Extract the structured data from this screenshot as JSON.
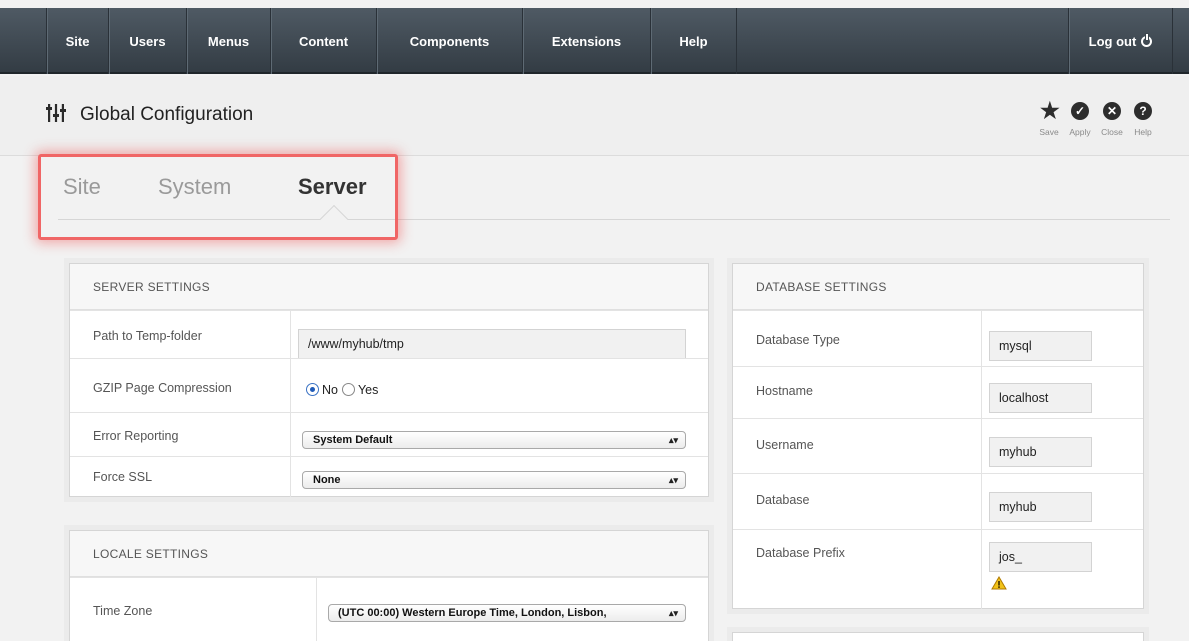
{
  "nav": {
    "items": [
      "Site",
      "Users",
      "Menus",
      "Content",
      "Components",
      "Extensions",
      "Help"
    ],
    "logout": "Log out"
  },
  "header": {
    "title": "Global Configuration",
    "toolbar": [
      "Save",
      "Apply",
      "Close",
      "Help"
    ]
  },
  "tabs": [
    {
      "label": "Site",
      "active": false
    },
    {
      "label": "System",
      "active": false
    },
    {
      "label": "Server",
      "active": true
    }
  ],
  "server_settings": {
    "title": "SERVER SETTINGS",
    "temp_path_label": "Path to Temp-folder",
    "temp_path_value": "/www/myhub/tmp",
    "gzip_label": "GZIP Page Compression",
    "gzip_options": [
      "No",
      "Yes"
    ],
    "gzip_selected": "No",
    "error_reporting_label": "Error Reporting",
    "error_reporting_value": "System Default",
    "force_ssl_label": "Force SSL",
    "force_ssl_value": "None"
  },
  "locale_settings": {
    "title": "LOCALE SETTINGS",
    "timezone_label": "Time Zone",
    "timezone_value": "(UTC 00:00) Western Europe Time, London, Lisbon,"
  },
  "database_settings": {
    "title": "DATABASE SETTINGS",
    "type_label": "Database Type",
    "type_value": "mysql",
    "hostname_label": "Hostname",
    "hostname_value": "localhost",
    "username_label": "Username",
    "username_value": "myhub",
    "database_label": "Database",
    "database_value": "myhub",
    "prefix_label": "Database Prefix",
    "prefix_value": "jos_"
  },
  "icons": {
    "config": "sliders-icon",
    "save": "star-icon",
    "apply": "check-circle-icon",
    "close": "x-circle-icon",
    "help": "question-circle-icon",
    "logout": "power-icon",
    "prefix_warning": "warning-icon"
  }
}
